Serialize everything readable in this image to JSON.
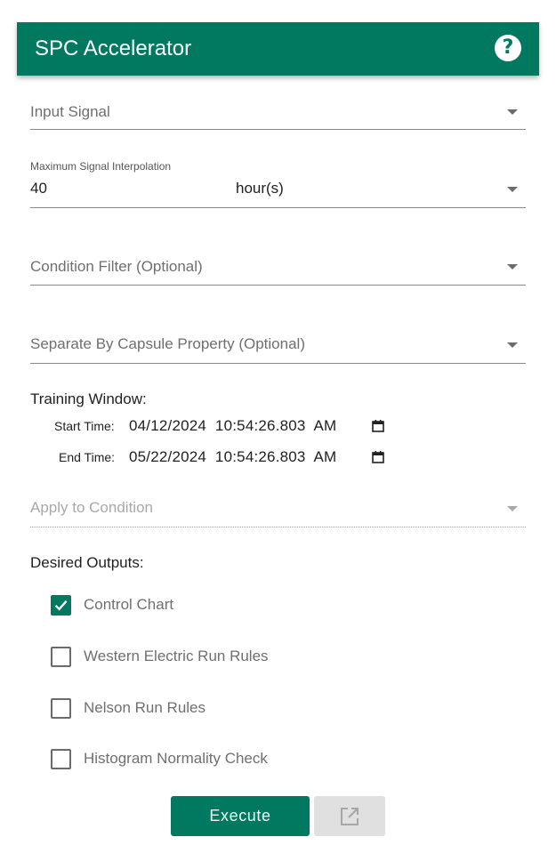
{
  "header": {
    "title": "SPC Accelerator",
    "help_glyph": "?"
  },
  "input_signal": {
    "label": "Input Signal"
  },
  "max_interpolation": {
    "label": "Maximum Signal Interpolation",
    "value": "40",
    "unit": "hour(s)"
  },
  "condition_filter": {
    "label": "Condition Filter (Optional)"
  },
  "separate_by": {
    "label": "Separate By Capsule Property (Optional)"
  },
  "training_window": {
    "label": "Training Window:",
    "start_label": "Start Time:",
    "start_value": "04/12/2024  10:54:26.803  AM",
    "end_label": "End Time:",
    "end_value": "05/22/2024  10:54:26.803  AM"
  },
  "apply_to_condition": {
    "label": "Apply to Condition"
  },
  "outputs": {
    "label": "Desired Outputs:",
    "items": [
      {
        "label": "Control Chart",
        "checked": true
      },
      {
        "label": "Western Electric Run Rules",
        "checked": false
      },
      {
        "label": "Nelson Run Rules",
        "checked": false
      },
      {
        "label": "Histogram Normality Check",
        "checked": false
      }
    ]
  },
  "actions": {
    "execute_label": "Execute",
    "open_icon": "open-in-new-icon"
  },
  "colors": {
    "accent": "#007960",
    "disabled_button": "#e0e0e0"
  }
}
